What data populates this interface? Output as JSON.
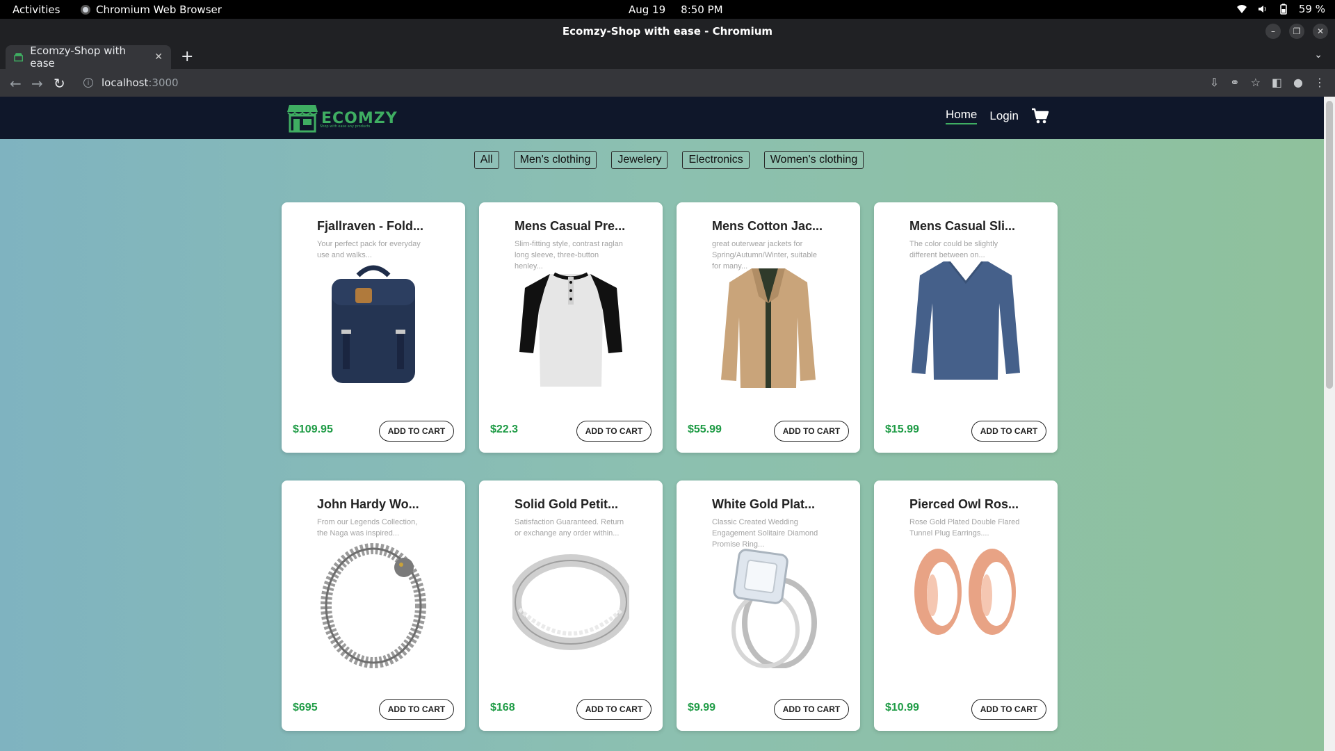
{
  "os": {
    "activities": "Activities",
    "app_name": "Chromium Web Browser",
    "date": "Aug 19",
    "time": "8:50 PM",
    "battery": "59 %"
  },
  "browser": {
    "window_title": "Ecomzy-Shop with ease - Chromium",
    "tab_title": "Ecomzy-Shop with ease",
    "url_host": "localhost",
    "url_port": ":3000"
  },
  "site": {
    "logo_text": "ECOMZY",
    "logo_tagline": "Shop with ease any products",
    "nav": {
      "home": "Home",
      "login": "Login"
    },
    "accent_color": "#3fae62",
    "price_color": "#1e9b45",
    "nav_bg": "#0f172a"
  },
  "filters": [
    "All",
    "Men's clothing",
    "Jewelery",
    "Electronics",
    "Women's clothing"
  ],
  "products": [
    {
      "title": "Fjallraven - Fold...",
      "desc": "Your perfect pack for everyday use and walks...",
      "price": "$109.95",
      "button": "ADD TO CART",
      "image": "backpack"
    },
    {
      "title": "Mens Casual Pre...",
      "desc": "Slim-fitting style, contrast raglan long sleeve, three-button henley...",
      "price": "$22.3",
      "button": "ADD TO CART",
      "image": "henley-shirt"
    },
    {
      "title": "Mens Cotton Jac...",
      "desc": "great outerwear jackets for Spring/Autumn/Winter, suitable for many...",
      "price": "$55.99",
      "button": "ADD TO CART",
      "image": "jacket"
    },
    {
      "title": "Mens Casual Sli...",
      "desc": "The color could be slightly different between on...",
      "price": "$15.99",
      "button": "ADD TO CART",
      "image": "sweater"
    },
    {
      "title": "John Hardy Wo...",
      "desc": "From our Legends Collection, the Naga was inspired...",
      "price": "$695",
      "button": "ADD TO CART",
      "image": "bracelet"
    },
    {
      "title": "Solid Gold Petit...",
      "desc": "Satisfaction Guaranteed. Return or exchange any order within...",
      "price": "$168",
      "button": "ADD TO CART",
      "image": "ring-band"
    },
    {
      "title": "White Gold Plat...",
      "desc": "Classic Created Wedding Engagement Solitaire Diamond Promise Ring...",
      "price": "$9.99",
      "button": "ADD TO CART",
      "image": "diamond-ring"
    },
    {
      "title": "Pierced Owl Ros...",
      "desc": "Rose Gold Plated Double Flared Tunnel Plug Earrings....",
      "price": "$10.99",
      "button": "ADD TO CART",
      "image": "plug-earrings"
    }
  ]
}
